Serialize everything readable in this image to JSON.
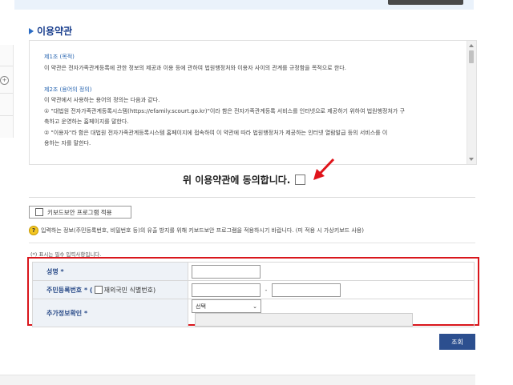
{
  "section": {
    "title": "이용약관"
  },
  "terms": {
    "lines": [
      {
        "text": "제1조 (목적)",
        "style": "title"
      },
      {
        "text": "이 약관은 전자가족관계등록에 관한 정보의 제공과 이용 등에 관하여 법원행정처와 이용자 사이의 관계를 규정함을 목적으로 한다.",
        "style": "body"
      },
      {
        "text": "",
        "style": "body"
      },
      {
        "text": "제2조 (용어의 정의)",
        "style": "title"
      },
      {
        "text": "이 약관에서 사용하는 용어의 정의는 다음과 같다.",
        "style": "body"
      },
      {
        "text": "① \"대법원 전자가족관계등록시스템(https://efamily.scourt.go.kr)\"이라 함은 전자가족관계등록 서비스를 인터넷으로 제공하기 위하여 법원행정처가 구",
        "style": "body"
      },
      {
        "text": "축하고 운영하는 홈페이지를 말한다.",
        "style": "body"
      },
      {
        "text": "② \"이용자\"라 함은 대법원 전자가족관계등록시스템 홈페이지에 접속하여 이 약관에 따라 법원행정처가 제공하는 인터넷 열람발급 등의 서비스를 이",
        "style": "body"
      },
      {
        "text": "용하는 자를 말한다.",
        "style": "body"
      }
    ]
  },
  "agree": {
    "label": "위 이용약관에 동의합니다."
  },
  "keyboard_security": {
    "label": "키보드보안 프로그램 적용"
  },
  "notice": {
    "icon_text": "?",
    "text": "입력하는 정보(주민등록번호, 비밀번호 등)의 유출 방지를 위해 키보드보안 프로그램을 적용하시기 바랍니다. (미 적용 시 가상키보드 사용)"
  },
  "required_note": "(*) 표시는 필수 입력사항입니다.",
  "form": {
    "name_label": "성명 *",
    "rrn_label": "주민등록번호 * (",
    "foreigner_label": "재외국민 식별번호)",
    "dash": "-",
    "extra_label": "추가정보확인 *",
    "select_value": "선택",
    "chevron": "⌄"
  },
  "search_button": "조회",
  "colors": {
    "accent": "#2c4f8f",
    "highlight": "#d9161c",
    "label_bg": "#eef2f7"
  }
}
